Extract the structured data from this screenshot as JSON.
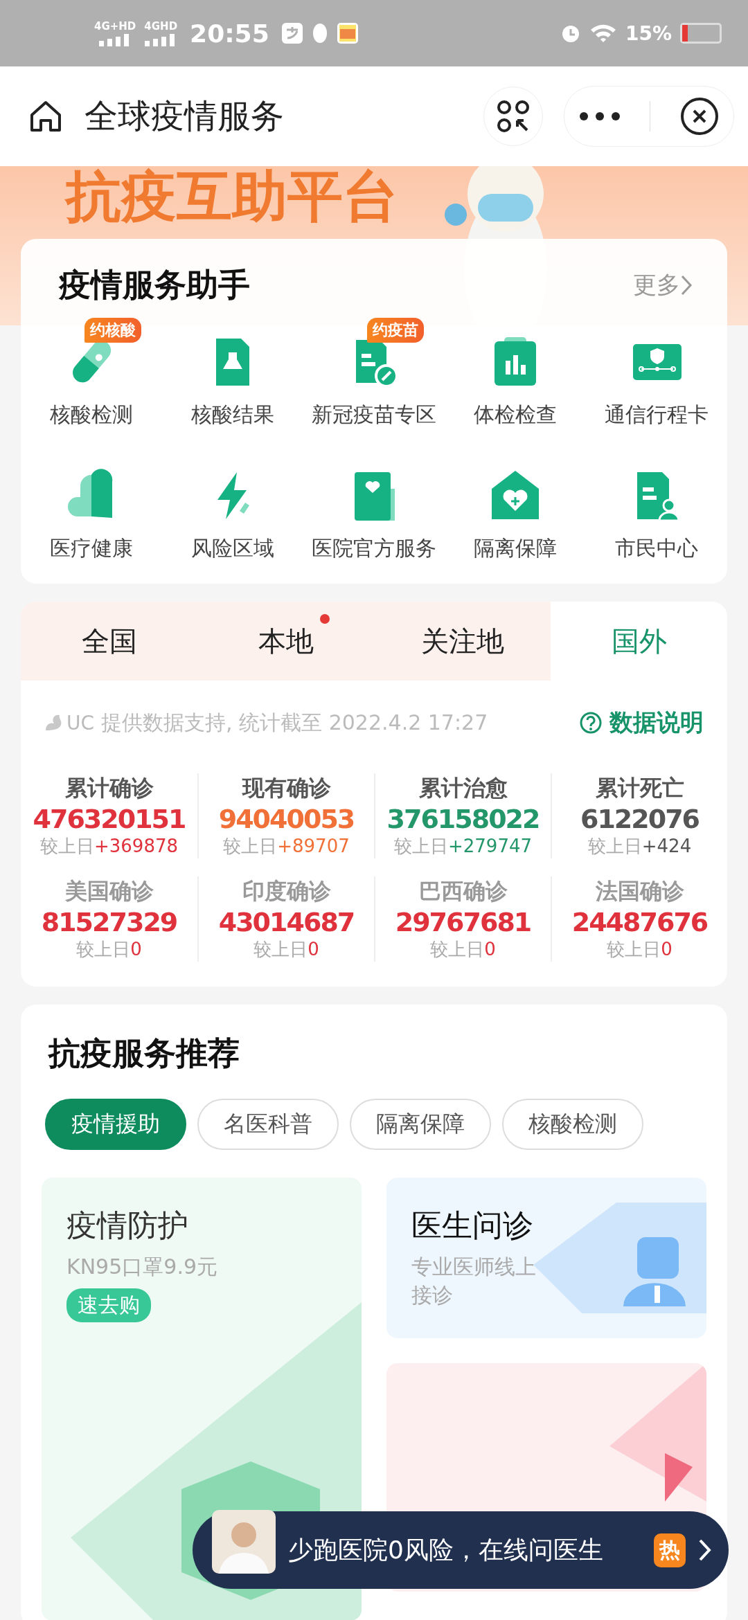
{
  "status_bar": {
    "networks": [
      "4G+HD",
      "4GHD"
    ],
    "time": "20:55",
    "battery": "15%"
  },
  "nav": {
    "title": "全球疫情服务"
  },
  "banner": {
    "title": "抗疫互助平台"
  },
  "services": {
    "title": "疫情服务助手",
    "more": "更多",
    "items": [
      {
        "label": "核酸检测",
        "kind": "tube",
        "badge": "约核酸"
      },
      {
        "label": "核酸结果",
        "kind": "flask"
      },
      {
        "label": "新冠疫苗专区",
        "kind": "vaccine",
        "badge": "约疫苗"
      },
      {
        "label": "体检检查",
        "kind": "chart"
      },
      {
        "label": "通信行程卡",
        "kind": "card"
      },
      {
        "label": "医疗健康",
        "kind": "heart"
      },
      {
        "label": "风险区域",
        "kind": "bolt"
      },
      {
        "label": "医院官方服务",
        "kind": "doc"
      },
      {
        "label": "隔离保障",
        "kind": "house"
      },
      {
        "label": "市民中心",
        "kind": "person"
      }
    ]
  },
  "region_tabs": [
    {
      "label": "全国",
      "selected": false,
      "dot": false
    },
    {
      "label": "本地",
      "selected": false,
      "dot": true
    },
    {
      "label": "关注地",
      "selected": false,
      "dot": false
    },
    {
      "label": "国外",
      "selected": true,
      "dot": false
    }
  ],
  "data": {
    "source_logo": "UC",
    "source": "提供数据支持, 统计截至 2022.4.2 17:27",
    "explain": "数据说明",
    "stats": [
      {
        "label": "累计确诊",
        "value": "476320151",
        "prefix": "较上日",
        "delta": "+369878",
        "color": "#e0323c",
        "muted": false
      },
      {
        "label": "现有确诊",
        "value": "94040053",
        "prefix": "较上日",
        "delta": "+89707",
        "color": "#f07038",
        "muted": false
      },
      {
        "label": "累计治愈",
        "value": "376158022",
        "prefix": "较上日",
        "delta": "+279747",
        "color": "#23966a",
        "muted": false
      },
      {
        "label": "累计死亡",
        "value": "6122076",
        "prefix": "较上日",
        "delta": "+424",
        "color": "#555555",
        "muted": false
      },
      {
        "label": "美国确诊",
        "value": "81527329",
        "prefix": "较上日",
        "delta": "0",
        "color": "#e0323c",
        "muted": true
      },
      {
        "label": "印度确诊",
        "value": "43014687",
        "prefix": "较上日",
        "delta": "0",
        "color": "#e0323c",
        "muted": true
      },
      {
        "label": "巴西确诊",
        "value": "29767681",
        "prefix": "较上日",
        "delta": "0",
        "color": "#e0323c",
        "muted": true
      },
      {
        "label": "法国确诊",
        "value": "24487676",
        "prefix": "较上日",
        "delta": "0",
        "color": "#e0323c",
        "muted": true
      }
    ]
  },
  "recommend": {
    "title": "抗疫服务推荐",
    "filters": [
      {
        "label": "疫情援助",
        "selected": true
      },
      {
        "label": "名医科普",
        "selected": false
      },
      {
        "label": "隔离保障",
        "selected": false
      },
      {
        "label": "核酸检测",
        "selected": false
      }
    ],
    "cards": [
      {
        "kind": "green",
        "title": "疫情防护",
        "subtitle": "KN95口罩9.9元",
        "action": "速去购"
      },
      {
        "kind": "blue",
        "title": "医生问诊",
        "subtitle": "专业医师线上接诊"
      },
      {
        "kind": "pink"
      }
    ]
  },
  "floating": {
    "text": "少跑医院0风险，在线问医生",
    "badge": "热"
  }
}
